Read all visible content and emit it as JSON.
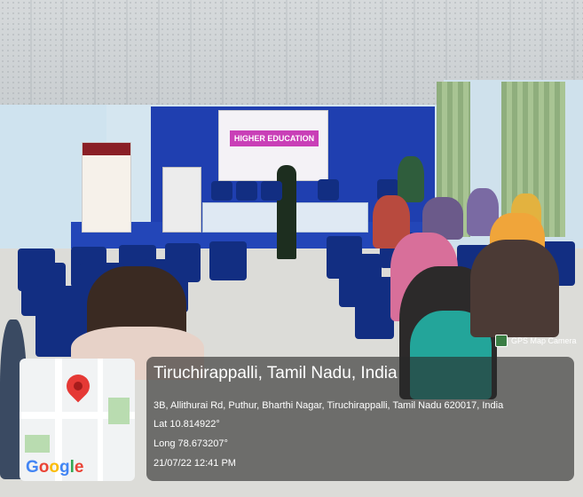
{
  "scene": {
    "screen_text": "HIGHER EDUCATION",
    "watermark_app": "GPS Map Camera"
  },
  "location": {
    "title": "Tiruchirappalli, Tamil Nadu, India",
    "address": "3B, Allithurai Rd, Puthur, Bharthi Nagar, Tiruchirappalli, Tamil Nadu 620017, India",
    "lat": "Lat 10.814922°",
    "long": "Long 78.673207°",
    "datetime": "21/07/22 12:41 PM"
  },
  "map": {
    "brand": "Google",
    "pin_icon": "map-pin-icon"
  },
  "colors": {
    "stage_blue": "#2346b8",
    "chair_blue": "#122e82",
    "overlay": "#282828"
  }
}
